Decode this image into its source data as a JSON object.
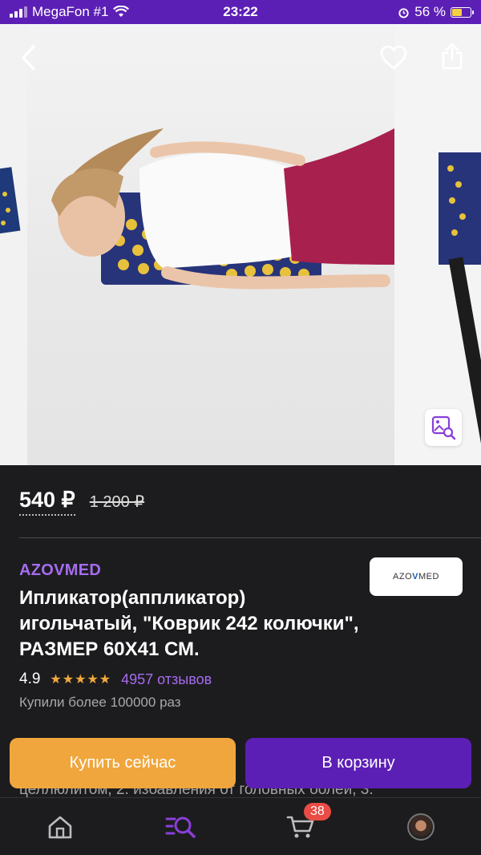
{
  "status_bar": {
    "carrier": "MegaFon #1",
    "time": "23:22",
    "battery": "56 %",
    "battery_level": 0.56
  },
  "gallery": {
    "back_icon": "chevron-left-icon",
    "favorite_icon": "heart-icon",
    "share_icon": "share-icon",
    "photo_search_icon": "image-search-icon"
  },
  "price": {
    "current": "540 ₽",
    "old": "1 200 ₽"
  },
  "product": {
    "brand": "AZOVMED",
    "brand_logo_left": "AZO",
    "brand_logo_mid": "V",
    "brand_logo_right": "MED",
    "title": "Ипликатор(аппликатор) игольчатый, \"Коврик 242 колючки\", РАЗМЕР 60Х41 СМ.",
    "rating": "4.9",
    "stars": "★★★★★",
    "reviews": "4957 отзывов",
    "bought": "Купили более 100000 раз",
    "description": "целлюлитом, 2. избавления от головных болей, 3."
  },
  "actions": {
    "buy_now": "Купить сейчас",
    "add_to_cart": "В корзину"
  },
  "bottom_nav": {
    "items": [
      {
        "icon": "home-icon"
      },
      {
        "icon": "catalog-search-icon"
      },
      {
        "icon": "cart-icon",
        "badge": "38"
      },
      {
        "icon": "profile-avatar"
      }
    ]
  },
  "colors": {
    "accent": "#5c1fb5",
    "brand": "#a56cf0",
    "buy_now": "#f0a63c",
    "stars": "#f2a93b",
    "badge": "#e94b45"
  }
}
